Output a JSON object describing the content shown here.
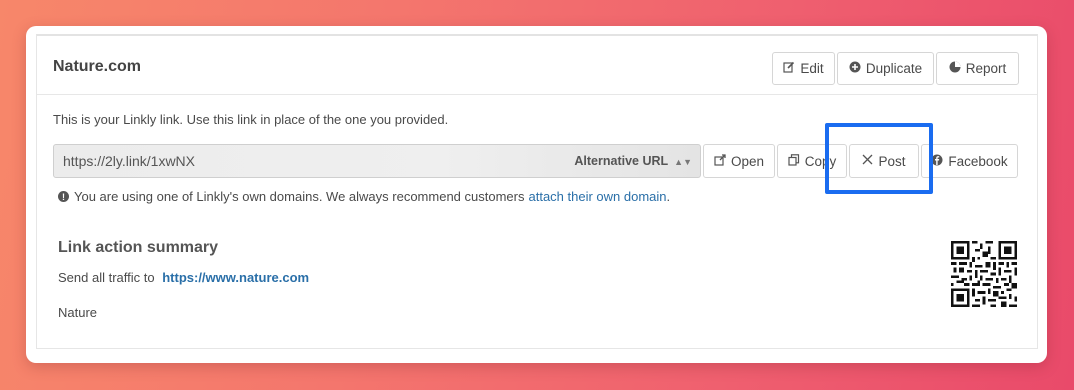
{
  "panel": {
    "title": "Nature.com",
    "actions": [
      {
        "label": "Edit",
        "icon": "edit-icon"
      },
      {
        "label": "Duplicate",
        "icon": "plus-circle-icon"
      },
      {
        "label": "Report",
        "icon": "pie-chart-icon"
      }
    ]
  },
  "link": {
    "description": "This is your Linkly link. Use this link in place of the one you provided.",
    "short_url": "https://2ly.link/1xwNX",
    "alt_url_label": "Alternative URL",
    "buttons": {
      "open": "Open",
      "copy": "Copy",
      "post": "Post",
      "facebook": "Facebook"
    }
  },
  "warning": {
    "text": "You are using one of Linkly's own domains. We always recommend customers",
    "link_text": "attach their own domain",
    "suffix": "."
  },
  "summary": {
    "title": "Link action summary",
    "traffic_prefix": "Send all traffic to",
    "traffic_url": "https://www.nature.com",
    "note": "Nature"
  },
  "colors": {
    "highlight": "#1a6cf0",
    "link": "#2a6fa8"
  }
}
